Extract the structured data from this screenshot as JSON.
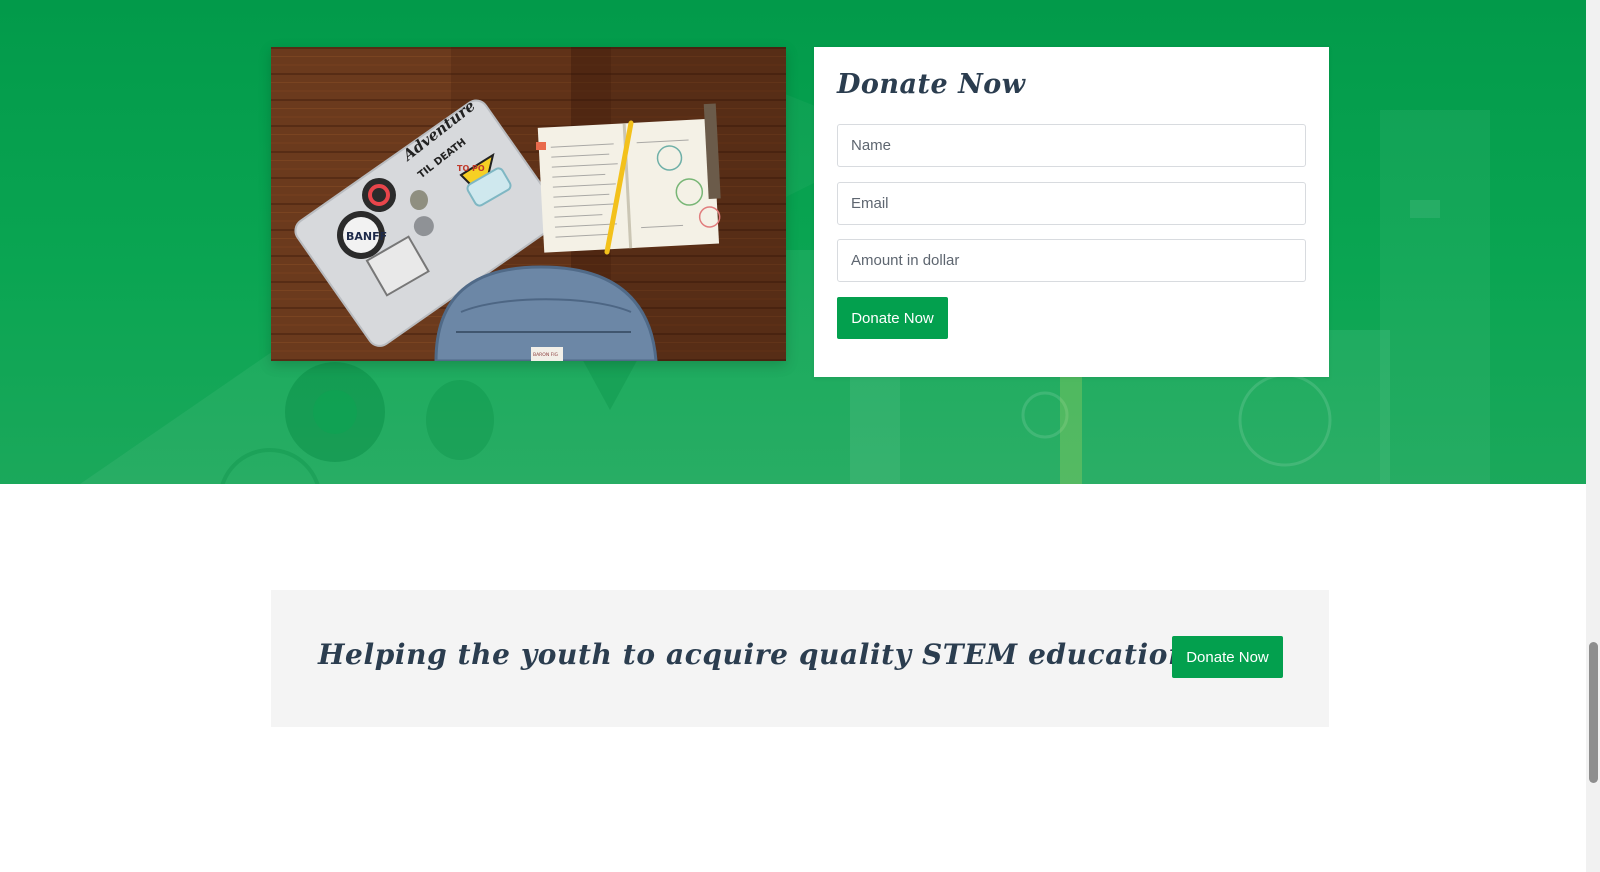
{
  "donate_form": {
    "title": "Donate Now",
    "name_placeholder": "Name",
    "email_placeholder": "Email",
    "amount_placeholder": "Amount in dollar",
    "submit_label": "Donate Now"
  },
  "cta": {
    "headline": "Helping the youth to acquire quality STEM education",
    "button_label": "Donate Now"
  },
  "photo": {
    "laptop_sticker_lettering": [
      "Adventure",
      "TIL DEATH",
      "TO PO",
      "BANFF"
    ],
    "bag_tag": "BARON FIG"
  },
  "colors": {
    "brand_green": "#03a04e",
    "hero_green": "#0aa552",
    "heading_navy": "#2b3d4f",
    "cta_background": "#f4f4f4"
  },
  "icons": [
    "laptop-sticker-icon",
    "apple-logo-icon",
    "backpack-zipper-icon"
  ]
}
